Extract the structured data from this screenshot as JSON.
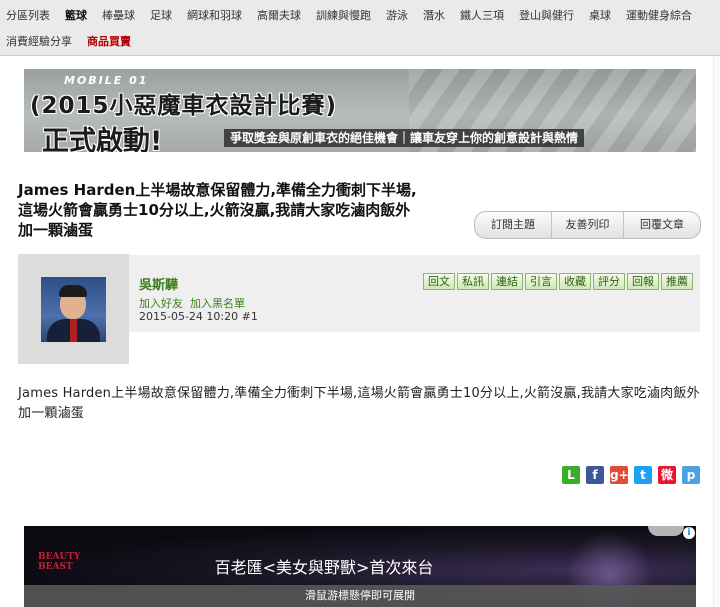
{
  "nav": {
    "row1": [
      "分區列表",
      "籃球",
      "棒壘球",
      "足球",
      "網球和羽球",
      "高爾夫球",
      "訓練與慢跑",
      "游泳",
      "潛水",
      "鐵人三項",
      "登山與健行",
      "桌球",
      "運動健身綜合"
    ],
    "row2": [
      "消費經驗分享",
      "商品買賣"
    ],
    "active": "籃球",
    "highlight": "商品買賣"
  },
  "banner": {
    "brand": "MOBILE 01",
    "title": "(2015小惡魔車衣設計比賽)",
    "start": "正式啟動!",
    "subtitle": "爭取獎金與原創車衣的絕佳機會｜讓車友穿上你的創意設計與熱情"
  },
  "thread": {
    "title": "James Harden上半場故意保留體力,準備全力衝刺下半場,這場火箭會贏勇士10分以上,火箭沒贏,我請大家吃滷肉飯外加一顆滷蛋",
    "actions": [
      "訂閱主題",
      "友善列印",
      "回覆文章"
    ]
  },
  "post": {
    "author": "吳斯驊",
    "author_links": [
      "加入好友",
      "加入黑名單"
    ],
    "meta": "2015-05-24 10:20 #1",
    "tools": [
      "回文",
      "私訊",
      "連結",
      "引言",
      "收藏",
      "評分",
      "回報",
      "推薦"
    ],
    "body": "James Harden上半場故意保留體力,準備全力衝刺下半場,這場火箭會贏勇士10分以上,火箭沒贏,我請大家吃滷肉飯外加一顆滷蛋"
  },
  "share": [
    {
      "icon": "line-icon",
      "glyph": "L",
      "color": "#3aae2a"
    },
    {
      "icon": "facebook-icon",
      "glyph": "f",
      "color": "#3b5998"
    },
    {
      "icon": "google-plus-icon",
      "glyph": "g+",
      "color": "#dd4b39"
    },
    {
      "icon": "twitter-icon",
      "glyph": "t",
      "color": "#1da1f2"
    },
    {
      "icon": "weibo-icon",
      "glyph": "微",
      "color": "#e6162d"
    },
    {
      "icon": "plurk-icon",
      "glyph": "p",
      "color": "#4aa3df"
    }
  ],
  "ad": {
    "logo": "BEAUTY BEAST",
    "headline": "百老匯<美女與野獸>首次來台",
    "strip": "滑鼠游標懸停即可展開",
    "info": "i"
  }
}
